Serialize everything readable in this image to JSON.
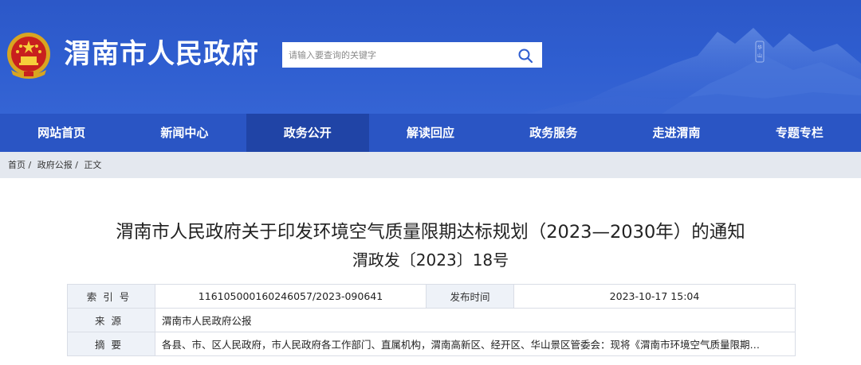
{
  "header": {
    "site_title": "渭南市人民政府",
    "search_placeholder": "请输入要查询的关键字",
    "emblem_icon": "national-emblem-icon",
    "search_icon": "search-icon",
    "brand_color": "#2f5ed0"
  },
  "nav": {
    "items": [
      {
        "label": "网站首页"
      },
      {
        "label": "新闻中心"
      },
      {
        "label": "政务公开"
      },
      {
        "label": "解读回应"
      },
      {
        "label": "政务服务"
      },
      {
        "label": "走进渭南"
      },
      {
        "label": "专题专栏"
      }
    ],
    "active_index": 2
  },
  "breadcrumb": {
    "home": "首页 /",
    "section": "政府公报 /",
    "current": "正文"
  },
  "document": {
    "title": "渭南市人民政府关于印发环境空气质量限期达标规划（2023—2030年）的通知",
    "number": "渭政发〔2023〕18号"
  },
  "meta": {
    "index_label": "索引号",
    "index_value": "11610500016024605 7/2023-090641",
    "publish_label": "发布时间",
    "publish_value": "2023-10-17 15:04",
    "source_label": "来源",
    "source_value": "渭南市人民政府公报",
    "abstract_label": "摘要",
    "abstract_value": "各县、市、区人民政府，市人民政府各工作部门、直属机构，渭南高新区、经开区、华山景区管委会：现将《渭南市环境空气质量限期…"
  }
}
